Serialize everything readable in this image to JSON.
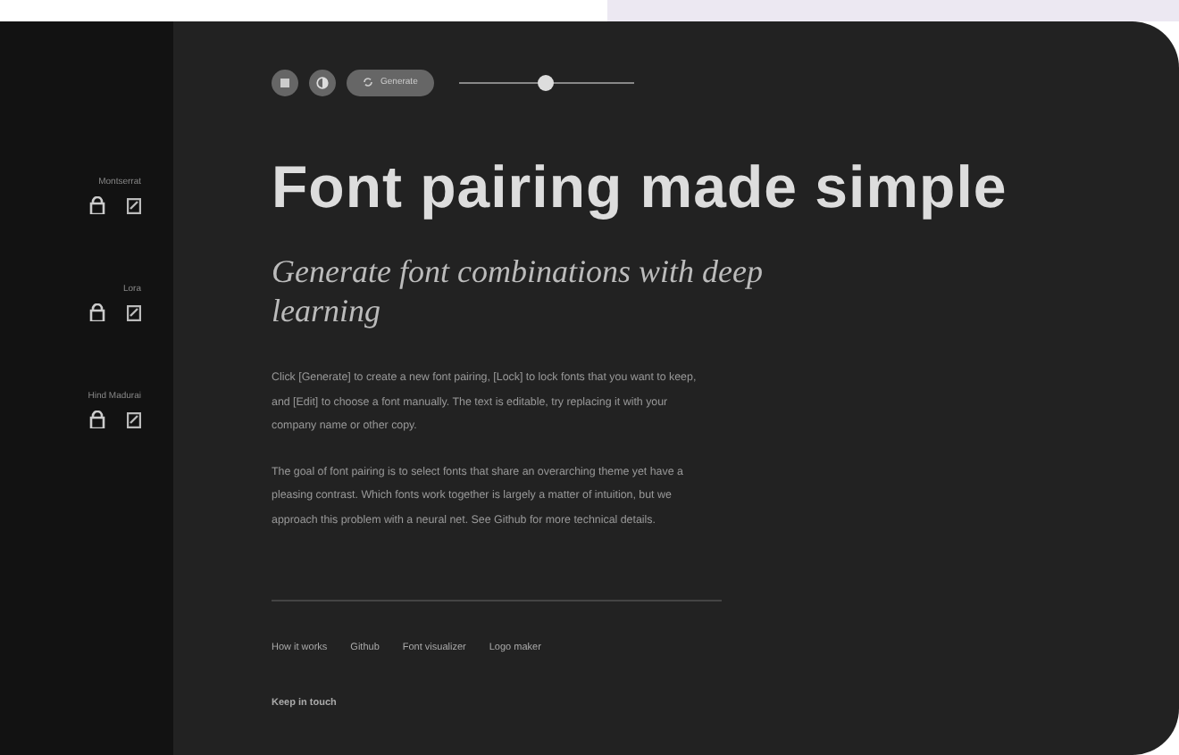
{
  "fonts": [
    {
      "name": "Montserrat"
    },
    {
      "name": "Lora"
    },
    {
      "name": "Hind Madurai"
    }
  ],
  "toolbar": {
    "generate_label": "Generate",
    "slider": {
      "level": 0.5
    }
  },
  "heading": "Font pairing made simple",
  "subheading": "Generate font combinations with deep learning",
  "paragraphs": [
    "Click [Generate] to create a new font pairing, [Lock] to lock fonts that you want to keep, and [Edit] to choose a font manually. The text is editable, try replacing it with your company name or other copy.",
    "The goal of font pairing is to select fonts that share an overarching theme yet have a pleasing contrast. Which fonts work together is largely a matter of intuition, but we approach this problem with a neural net. See Github for more technical details."
  ],
  "footer_links": [
    "How it works",
    "Github",
    "Font visualizer",
    "Logo maker"
  ],
  "footer_heading": "Keep in touch"
}
